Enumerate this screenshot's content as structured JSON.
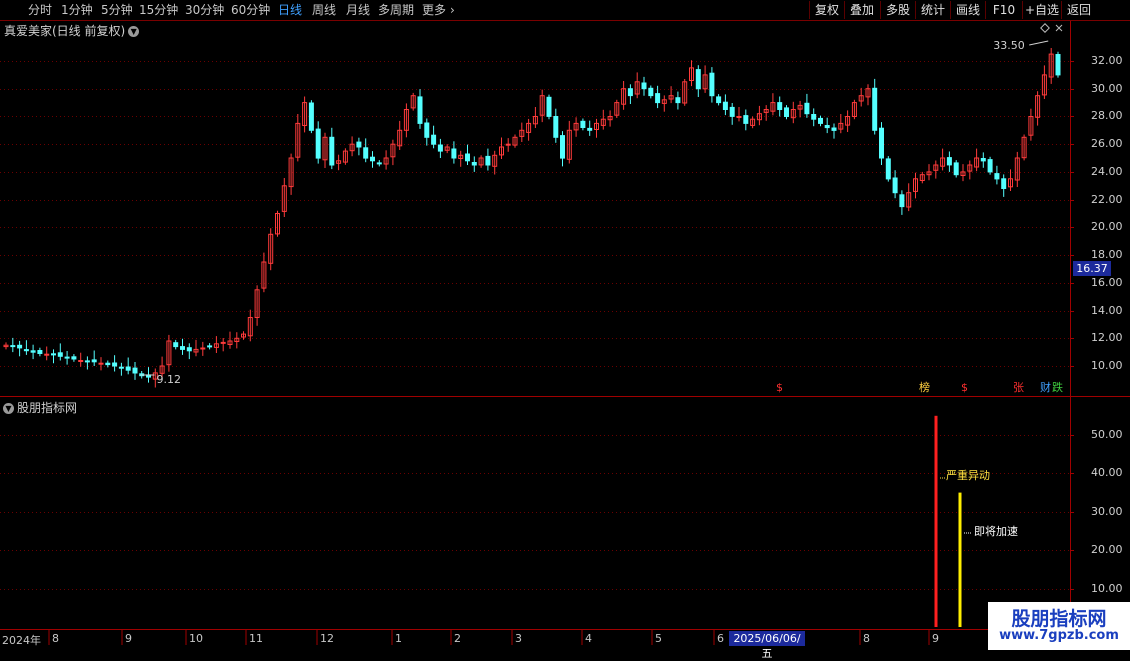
{
  "toolbar": {
    "periods": [
      "分时",
      "1分钟",
      "5分钟",
      "15分钟",
      "30分钟",
      "60分钟",
      "日线",
      "周线",
      "月线",
      "多周期",
      "更多"
    ],
    "active_period": "日线",
    "buttons": [
      "复权",
      "叠加",
      "多股",
      "统计",
      "画线",
      "F10",
      "+自选",
      "返回"
    ]
  },
  "main": {
    "title": "真爱美家(日线 前复权)",
    "y_ticks": [
      "32.00",
      "30.00",
      "28.00",
      "26.00",
      "24.00",
      "22.00",
      "20.00",
      "18.00",
      "16.00",
      "14.00",
      "12.00",
      "10.00"
    ],
    "current_price_tag": "16.37",
    "high_annotation": "33.50",
    "low_annotation": "9.12",
    "flags": [
      {
        "text": "$",
        "color": "#ff3030"
      },
      {
        "text": "榜",
        "color": "#ffd040"
      },
      {
        "text": "$",
        "color": "#ff3030"
      },
      {
        "text": "张",
        "color": "#ff3030"
      },
      {
        "text": "财",
        "color": "#40a0ff"
      },
      {
        "text": "跌",
        "color": "#40d040"
      }
    ]
  },
  "sub": {
    "title": "股朋指标网",
    "y_ticks": [
      "50.00",
      "40.00",
      "30.00",
      "20.00",
      "10.00"
    ],
    "label_red": "严重异动",
    "label_white": "即将加速"
  },
  "x_axis": {
    "labels": [
      "2024年",
      "8",
      "9",
      "10",
      "11",
      "12",
      "1",
      "2",
      "3",
      "4",
      "5",
      "6",
      "8",
      "9"
    ],
    "selected_date": "2025/06/06/五"
  },
  "watermark": {
    "title": "股朋指标网",
    "url": "www.7gpzb.com"
  },
  "colors": {
    "up": "#ff3b3b",
    "down": "#54ffff",
    "grid": "#6a0000",
    "border": "#a00000",
    "signal_red": "#ff2020",
    "signal_yellow": "#ffee00"
  },
  "chart_data": {
    "type": "candlestick",
    "title": "真爱美家(日线 前复权)",
    "ylim": [
      8.5,
      34.5
    ],
    "high_label": 33.5,
    "low_label": 9.12,
    "last_price": 16.37,
    "close_series": [
      11.5,
      11.4,
      11.3,
      11.1,
      11.0,
      10.9,
      10.85,
      10.8,
      10.7,
      10.6,
      10.5,
      10.4,
      10.35,
      10.3,
      10.2,
      10.1,
      10.0,
      9.9,
      9.7,
      9.5,
      9.3,
      9.2,
      9.5,
      10.0,
      11.8,
      11.4,
      11.2,
      11.1,
      11.2,
      11.3,
      11.4,
      11.6,
      11.7,
      11.8,
      12.0,
      12.3,
      13.5,
      15.5,
      17.5,
      19.5,
      21.0,
      23.0,
      25.0,
      27.5,
      29.0,
      27.0,
      25.0,
      26.5,
      24.5,
      24.8,
      25.5,
      26.0,
      25.8,
      25.0,
      24.8,
      24.6,
      25.0,
      26.0,
      27.0,
      28.5,
      29.5,
      27.5,
      26.5,
      26.0,
      25.5,
      25.8,
      25.0,
      25.2,
      24.8,
      24.5,
      25.0,
      24.5,
      25.2,
      25.8,
      26.0,
      26.5,
      27.0,
      27.5,
      28.0,
      29.5,
      28.0,
      26.5,
      25.0,
      27.0,
      27.5,
      27.2,
      27.0,
      27.5,
      27.8,
      28.0,
      29.0,
      30.0,
      29.5,
      30.5,
      30.0,
      29.5,
      29.0,
      29.2,
      29.5,
      29.0,
      30.5,
      31.5,
      30.0,
      31.0,
      29.5,
      29.0,
      28.5,
      28.0,
      28.0,
      27.5,
      27.8,
      28.2,
      28.5,
      29.0,
      28.5,
      28.0,
      28.5,
      28.8,
      28.2,
      27.8,
      27.5,
      27.2,
      27.0,
      27.5,
      28.0,
      29.0,
      29.5,
      30.0,
      27.0,
      25.0,
      23.5,
      22.5,
      21.5,
      22.5,
      23.5,
      23.8,
      24.0,
      24.5,
      25.0,
      24.5,
      23.8,
      24.0,
      24.5,
      25.0,
      24.8,
      24.0,
      23.5,
      22.8,
      23.5,
      25.0,
      26.5,
      28.0,
      29.5,
      31.0,
      32.5,
      31.0
    ],
    "signals": [
      {
        "label": "严重异动",
        "value": 55,
        "color": "red"
      },
      {
        "label": "即将加速",
        "value": 35,
        "color": "yellow"
      }
    ],
    "sub_ylim": [
      0,
      58
    ]
  }
}
